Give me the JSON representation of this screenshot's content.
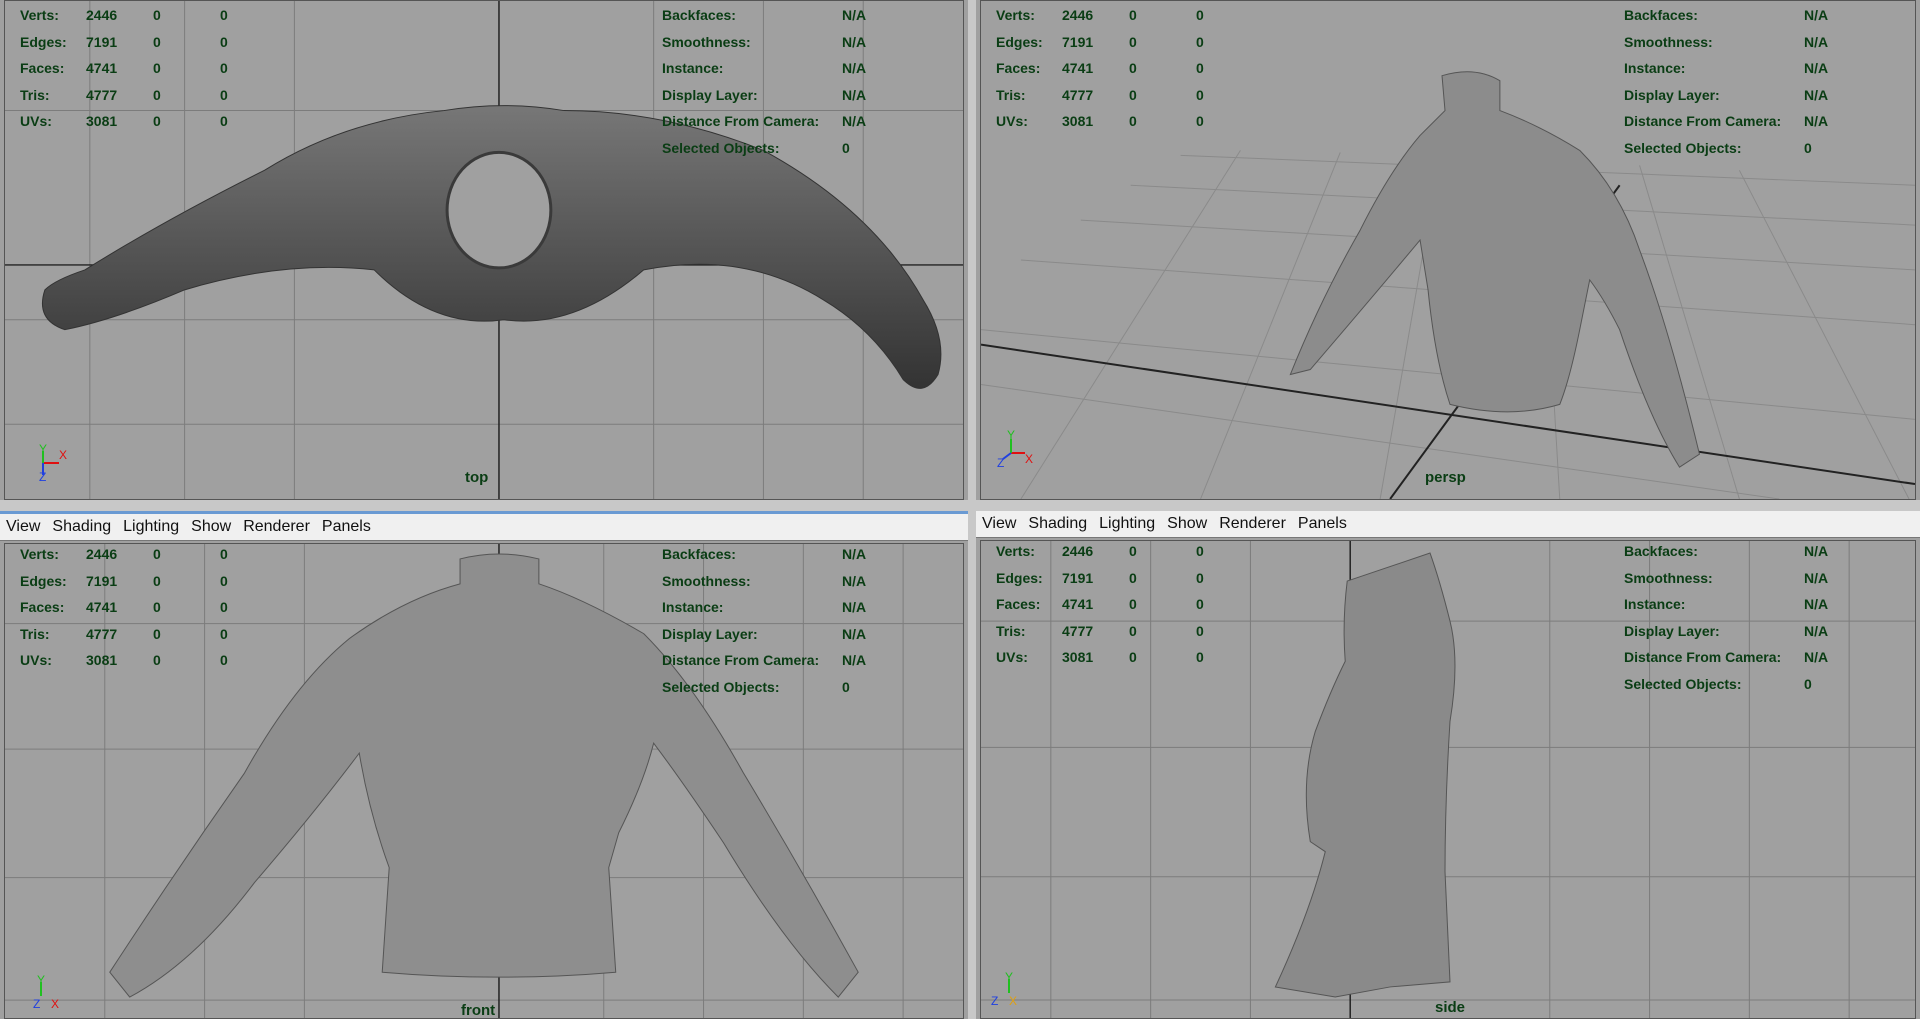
{
  "menus": [
    "View",
    "Shading",
    "Lighting",
    "Show",
    "Renderer",
    "Panels"
  ],
  "stats_labels": [
    "Verts:",
    "Edges:",
    "Faces:",
    "Tris:",
    "UVs:"
  ],
  "stats_values": [
    [
      "2446",
      "0",
      "0"
    ],
    [
      "7191",
      "0",
      "0"
    ],
    [
      "4741",
      "0",
      "0"
    ],
    [
      "4777",
      "0",
      "0"
    ],
    [
      "3081",
      "0",
      "0"
    ]
  ],
  "info_labels": [
    "Backfaces:",
    "Smoothness:",
    "Instance:",
    "Display Layer:",
    "Distance From Camera:",
    "Selected Objects:"
  ],
  "info_values": [
    "N/A",
    "N/A",
    "N/A",
    "N/A",
    "N/A",
    "0"
  ],
  "viewports": {
    "top": {
      "camera": "top",
      "axis": [
        "Y",
        "X",
        "Z"
      ]
    },
    "persp": {
      "camera": "persp",
      "axis": [
        "Y",
        "Z",
        "X"
      ]
    },
    "front": {
      "camera": "front",
      "axis": [
        "Y",
        "Z",
        "X"
      ]
    },
    "side": {
      "camera": "side",
      "axis": [
        "Y",
        "Z",
        "X"
      ]
    }
  },
  "colors": {
    "hud_text": "#0a3d14",
    "viewport_bg": "#a0a0a0",
    "grid": "#7c7c7c",
    "axis_x": "#e01010",
    "axis_y": "#20c020",
    "axis_z": "#2040e0",
    "active_border": "#6a9ad3"
  }
}
